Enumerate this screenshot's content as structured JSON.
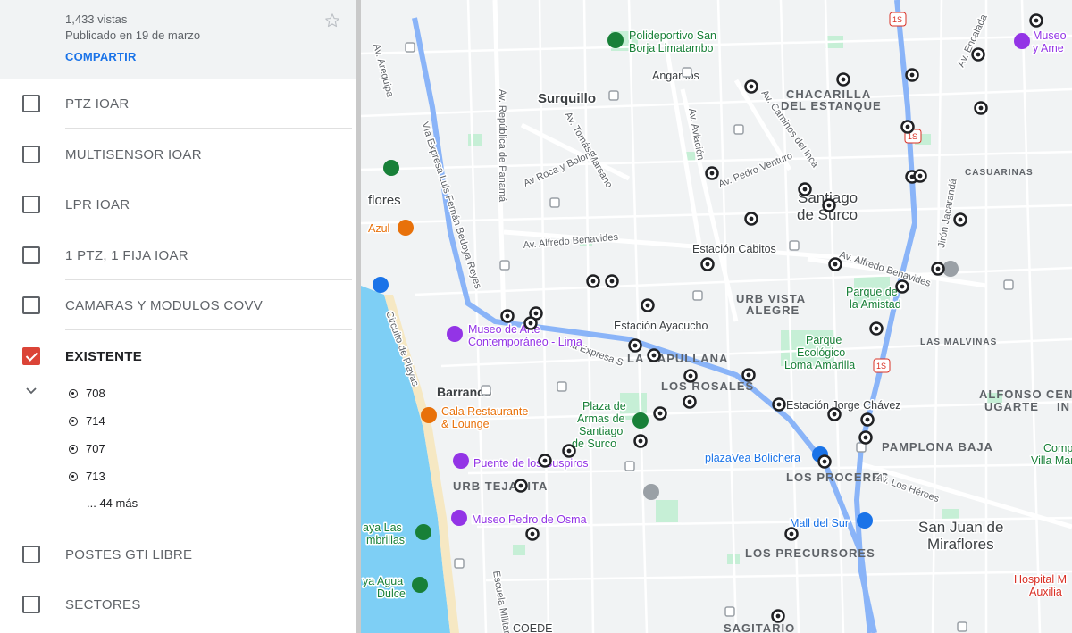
{
  "header": {
    "views": "1,433 vistas",
    "published": "Publicado en 19 de marzo",
    "share_label": "COMPARTIR"
  },
  "layers": [
    {
      "name": "PTZ IOAR",
      "checked": false
    },
    {
      "name": "MULTISENSOR IOAR",
      "checked": false
    },
    {
      "name": "LPR IOAR",
      "checked": false
    },
    {
      "name": "1 PTZ, 1 FIJA IOAR",
      "checked": false
    },
    {
      "name": "CAMARAS Y MODULOS COVV",
      "checked": false
    },
    {
      "name": "EXISTENTE",
      "checked": true
    },
    {
      "name": "POSTES GTI LIBRE",
      "checked": false
    },
    {
      "name": "SECTORES",
      "checked": false
    }
  ],
  "features": [
    "708",
    "714",
    "707",
    "713"
  ],
  "more_label": "... 44 más",
  "map": {
    "districts": [
      "CHACARILLA",
      "DEL ESTANQUE",
      "URB VISTA",
      "ALEGRE",
      "LA CAPULLANA",
      "LOS ROSALES",
      "URB TEJADITA",
      "PAMPLONA BAJA",
      "ALFONSO",
      "UGARTE",
      "LOS PROCERES",
      "LOS PRECURSORES",
      "SAGITARIO",
      "LAS MALVINAS",
      "CASUARINAS",
      "CENT",
      "IN"
    ],
    "cities": [
      "Surquillo",
      "Santiago",
      "de Surco",
      "Barranco",
      "San Juan de",
      "Miraflores",
      "flores"
    ],
    "roads": [
      "Av. República de Panamá",
      "Av. Tomás Marsano",
      "Av. Aviación",
      "Av Roca y Bolona",
      "Av. Caminos del Inca",
      "Av. Pedro Venturo",
      "Av. Alfredo Benavides",
      "Av. Alfredo Benavides",
      "Vía Expresa Luis Fernán Bedoya Reyes",
      "Vía Expresa S",
      "Circuito de Playas",
      "Av. Arequipa",
      "Av. Encalada",
      "Jirón Jacarandá",
      "Av. Los Héroes",
      "Escuela Militar"
    ],
    "pois": {
      "polideportivo": [
        "Polideportivo San",
        "Borja Limatambo"
      ],
      "angamos": "Angamos",
      "museo_top": [
        "Museo",
        "y Ame"
      ],
      "cabitos": "Estación Cabitos",
      "parque_amistad": [
        "Parque de",
        "la Amistad"
      ],
      "ayacucho": "Estación Ayacucho",
      "mac": [
        "Museo de Arte",
        "Contemporáneo - Lima"
      ],
      "loma": [
        "Parque",
        "Ecológico",
        "Loma Amarilla"
      ],
      "plaza_armas": [
        "Plaza de",
        "Armas de",
        "Santiago",
        "de Surco"
      ],
      "jorge_chavez": "Estación Jorge Chávez",
      "cala": [
        "Cala Restaurante",
        "& Lounge"
      ],
      "plazavea": "plazaVea Bolichera",
      "puente": "Puente de los Suspiros",
      "complejo": [
        "Compl",
        "Villa Mar"
      ],
      "mall": "Mall del Sur",
      "osma": "Museo Pedro de Osma",
      "playa_sombrillas": [
        "aya Las",
        "mbrillas"
      ],
      "playa_agua": [
        "ya Agua",
        "Dulce"
      ],
      "hospital": [
        "Hospital M",
        "Auxilia"
      ],
      "azul": "Azul",
      "coede": "COEDE"
    },
    "highway_badge": "1S",
    "cameras": [
      708,
      714,
      707,
      713
    ]
  },
  "colors": {
    "accent": "#1a73e8",
    "checkbox_checked": "#db4437",
    "water": "#7ecff5",
    "park": "#c6efd6",
    "road_major": "#ffffff",
    "highway": "#8ab4f8"
  }
}
